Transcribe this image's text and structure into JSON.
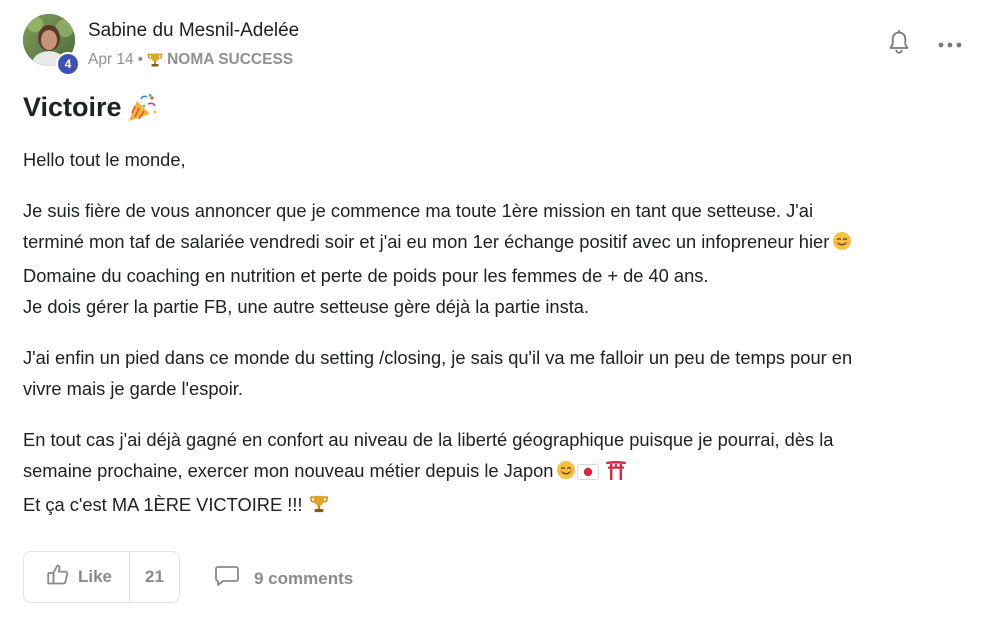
{
  "author": {
    "name": "Sabine du Mesnil-Adelée",
    "level": "4",
    "avatar_icon": "avatar-photo"
  },
  "meta": {
    "date": "Apr 14",
    "separator": "•",
    "category_icon": "trophy-icon",
    "category": "NOMA SUCCESS"
  },
  "actions": {
    "bell_icon": "bell-icon",
    "more_icon": "more-horizontal-icon"
  },
  "post": {
    "title": "Victoire",
    "title_emoji": "party-popper-emoji",
    "greeting": "Hello tout le monde,",
    "p1_line1": "Je suis fière de vous annoncer que je commence ma toute 1ère mission en tant que setteuse. J'ai",
    "p1_line2": "terminé mon taf de salariée vendredi soir et j'ai eu mon 1er échange positif avec un infopreneur hier",
    "p1_line3": "Domaine du coaching en nutrition et perte de poids pour les femmes de + de 40 ans.",
    "p1_line4": "Je dois gérer la partie FB, une autre setteuse gère déjà la partie insta.",
    "p2_line1": "J'ai enfin un pied dans ce monde du setting /closing, je sais qu'il va me falloir un peu de temps pour en",
    "p2_line2": "vivre mais je garde l'espoir.",
    "p3_line1": "En tout cas j'ai déjà gagné en confort au niveau de la liberté géographique puisque je pourrai, dès la",
    "p3_line2": "semaine prochaine, exercer mon nouveau métier depuis le Japon",
    "p3_line3": "Et ça c'est MA 1ÈRE VICTOIRE !!!"
  },
  "footer": {
    "like_label": "Like",
    "like_count": "21",
    "comments_label": "9 comments"
  },
  "colors": {
    "text": "#202124",
    "muted": "#909090",
    "badge": "#3f51b5",
    "border": "#e2e2e2"
  }
}
